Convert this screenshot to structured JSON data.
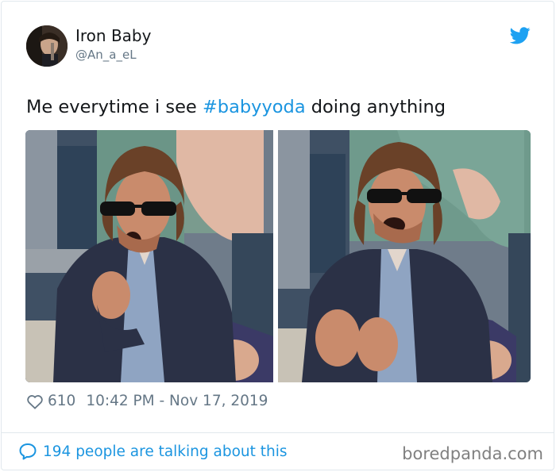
{
  "tweet": {
    "display_name": "Iron Baby",
    "handle": "@An_a_eL",
    "text_before": "Me everytime i see ",
    "hashtag": "#babyyoda",
    "text_after": " doing anything",
    "like_count": "610",
    "timestamp": "10:42 PM - Nov 17, 2019",
    "talking": "194 people are talking about this"
  },
  "watermark": "boredpanda.com",
  "icons": {
    "twitter_logo": "twitter-bird-icon",
    "like": "heart-icon",
    "reply": "speech-bubble-icon"
  },
  "colors": {
    "link": "#1b95e0",
    "secondary_text": "#657786",
    "twitter_blue": "#1da1f2"
  }
}
